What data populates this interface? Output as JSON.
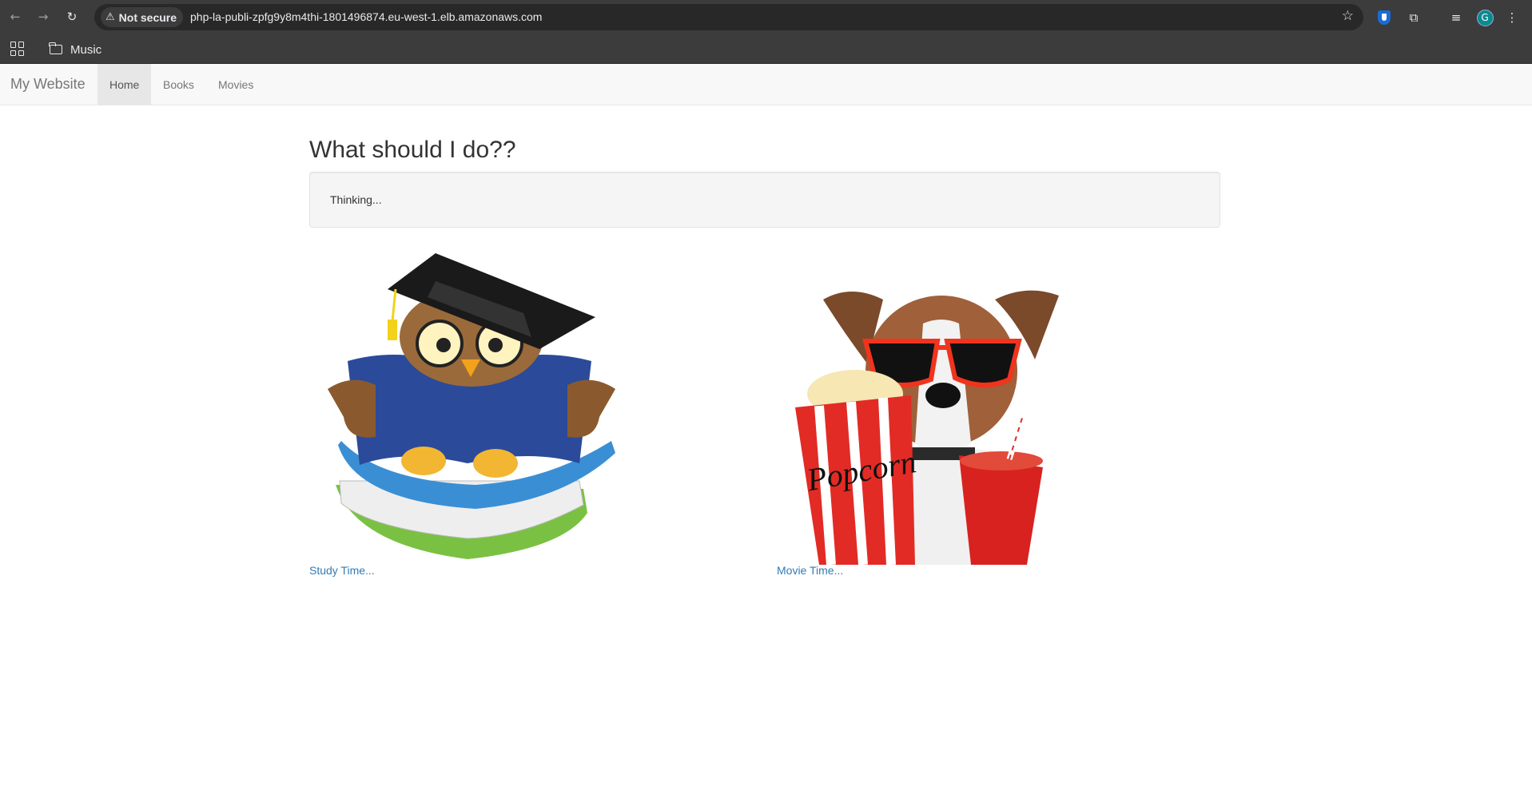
{
  "browser": {
    "security_label": "Not secure",
    "url": "php-la-publi-zpfg9y8m4thi-1801496874.eu-west-1.elb.amazonaws.com",
    "bookmarks": [
      {
        "label": "Music",
        "icon": "folder-icon"
      }
    ],
    "avatar_letter": "G"
  },
  "navbar": {
    "brand": "My Website",
    "links": [
      {
        "label": "Home",
        "active": true
      },
      {
        "label": "Books",
        "active": false
      },
      {
        "label": "Movies",
        "active": false
      }
    ]
  },
  "main": {
    "heading": "What should I do??",
    "status": "Thinking...",
    "cards": [
      {
        "image": "owl-reading-books-illustration",
        "link": "Study Time..."
      },
      {
        "image": "dog-with-popcorn-and-soda-illustration",
        "link": "Movie Time..."
      }
    ]
  },
  "colors": {
    "link": "#337ab7",
    "navbar_bg": "#f8f8f8",
    "well_bg": "#f5f5f5",
    "chrome_bg": "#3c3c3c"
  }
}
